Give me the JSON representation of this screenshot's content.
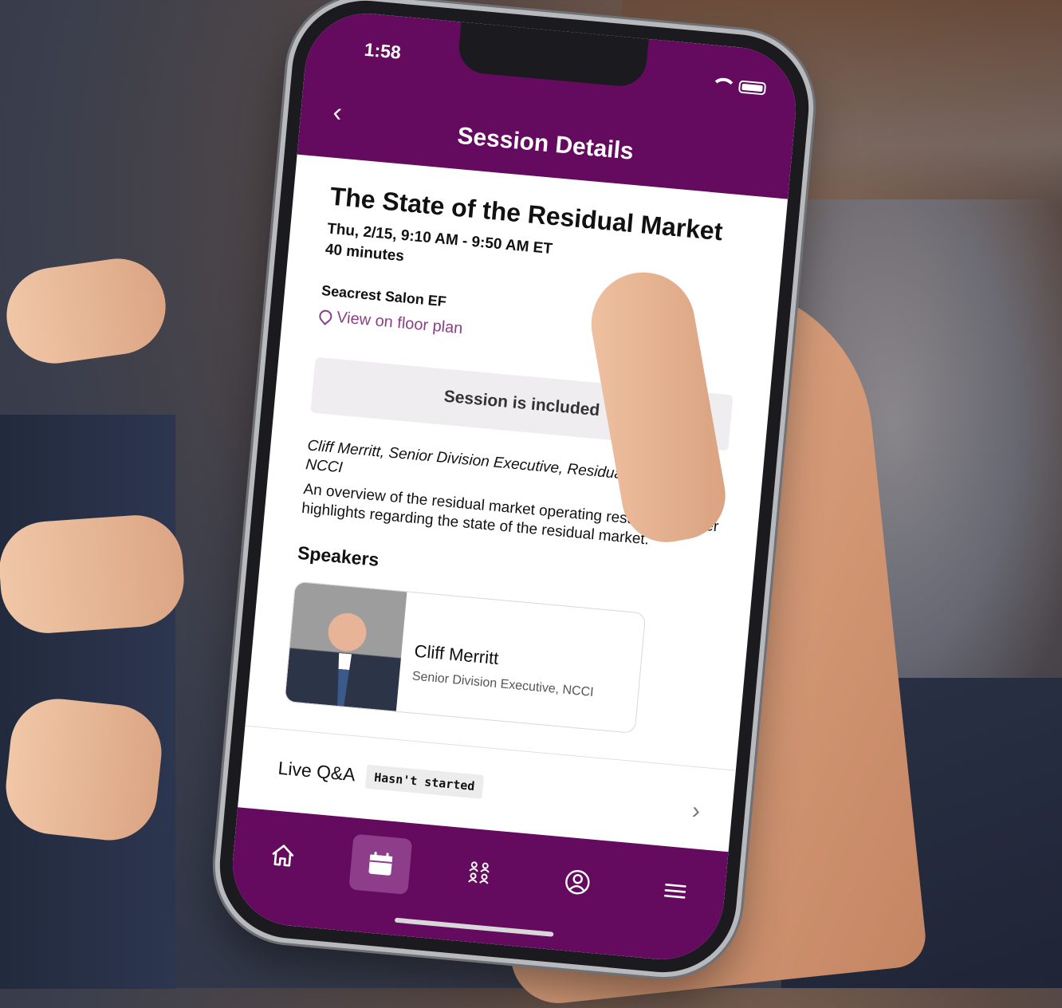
{
  "status_bar": {
    "time": "1:58"
  },
  "header": {
    "back": "‹",
    "title": "Session Details"
  },
  "session": {
    "title": "The State of the Residual Market",
    "datetime": "Thu, 2/15, 9:10 AM - 9:50 AM ET",
    "duration": "40 minutes",
    "room": "Seacrest Salon EF",
    "floor_plan_link": "View on floor plan",
    "included_label": "Session is included",
    "speaker_line": "Cliff Merritt, Senior Division Executive, Residual Markets, NCCI",
    "description": "An overview of the residual market operating results and other highlights regarding the state of the residual market."
  },
  "speakers": {
    "heading": "Speakers",
    "items": [
      {
        "name": "Cliff Merritt",
        "role": "Senior Division Executive, NCCI"
      }
    ]
  },
  "live_qa": {
    "label": "Live Q&A",
    "status": "Hasn't started",
    "chevron": "›"
  },
  "tabbar": {
    "items": [
      {
        "icon": "home-icon",
        "active": false
      },
      {
        "icon": "calendar-icon",
        "active": true
      },
      {
        "icon": "attendees-icon",
        "active": false
      },
      {
        "icon": "profile-icon",
        "active": false
      },
      {
        "icon": "menu-icon",
        "active": false
      }
    ]
  },
  "colors": {
    "brand": "#640a5f",
    "link": "#8b3f86",
    "included_bg": "#efedef"
  }
}
